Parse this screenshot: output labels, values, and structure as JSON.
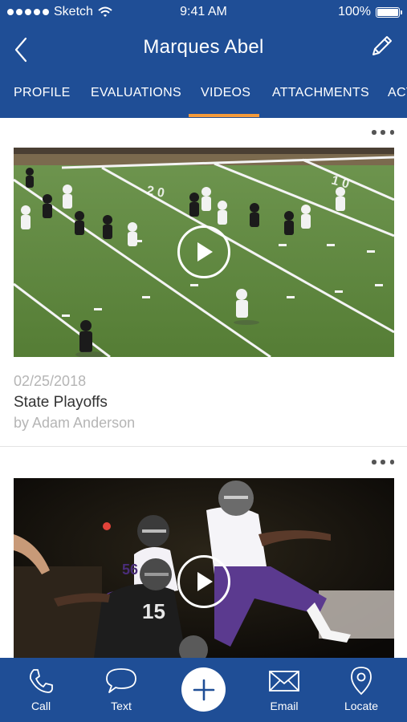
{
  "status_bar": {
    "carrier": "Sketch",
    "time": "9:41 AM",
    "battery": "100%"
  },
  "header": {
    "title": "Marques Abel",
    "back_icon": "chevron-left-icon",
    "edit_icon": "pencil-icon"
  },
  "tabs": [
    {
      "label": "PROFILE",
      "active": false
    },
    {
      "label": "EVALUATIONS",
      "active": false
    },
    {
      "label": "VIDEOS",
      "active": true
    },
    {
      "label": "ATTACHMENTS",
      "active": false
    },
    {
      "label": "ACT",
      "active": false
    }
  ],
  "videos": [
    {
      "date": "02/25/2018",
      "title": "State Playoffs",
      "author": "by Adam Anderson",
      "more_icon": "more-horizontal-icon",
      "play_icon": "play-icon"
    },
    {
      "more_icon": "more-horizontal-icon",
      "play_icon": "play-icon",
      "jersey_numbers": [
        "56",
        "15"
      ]
    }
  ],
  "bottom_bar": {
    "items": [
      {
        "label": "Call",
        "icon": "phone-icon"
      },
      {
        "label": "Text",
        "icon": "chat-bubble-icon"
      },
      {
        "label": "",
        "icon": "plus-icon"
      },
      {
        "label": "Email",
        "icon": "envelope-icon"
      },
      {
        "label": "Locate",
        "icon": "location-pin-icon"
      }
    ]
  },
  "colors": {
    "brand_blue": "#1f4e96",
    "tab_indicator": "#f39a3b",
    "field_green": "#5c8a3a",
    "muted_text": "#b5b5b5"
  }
}
